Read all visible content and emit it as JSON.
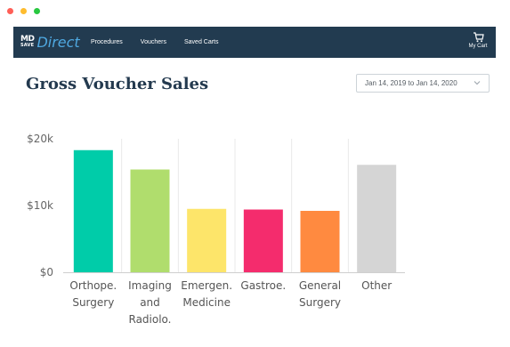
{
  "window": {
    "controls": [
      {
        "name": "close",
        "color": "#ff5f57"
      },
      {
        "name": "minimize",
        "color": "#febc2e"
      },
      {
        "name": "maximize",
        "color": "#28c840"
      }
    ]
  },
  "navbar": {
    "background": "#223b50",
    "logo": {
      "md": "MD",
      "save": "SAVE",
      "direct": "Direct"
    },
    "links": [
      "Procedures",
      "Vouchers",
      "Saved Carts"
    ],
    "cart_label": "My Cart",
    "cart_icon": "shopping-cart-icon"
  },
  "page": {
    "title": "Gross Voucher Sales",
    "date_range": "Jan 14, 2019 to Jan 14, 2020",
    "date_range_icon": "chevron-down-icon"
  },
  "chart_data": {
    "type": "bar",
    "categories": [
      [
        "Orthope.",
        "Surgery"
      ],
      [
        "Imaging",
        "and",
        "Radiolo."
      ],
      [
        "Emergen.",
        "Medicine"
      ],
      [
        "Gastroe."
      ],
      [
        "General",
        "Surgery"
      ],
      [
        "Other"
      ]
    ],
    "values": [
      18300,
      15400,
      9500,
      9400,
      9200,
      16100
    ],
    "colors": [
      "#00cca9",
      "#b0dd6d",
      "#fde56a",
      "#f42c6d",
      "#ff8a40",
      "#d5d5d5"
    ],
    "ylim": [
      0,
      20000
    ],
    "yticks": [
      0,
      10000,
      20000
    ],
    "ytick_labels": [
      "$0",
      "$10k",
      "$20k"
    ],
    "grid": "vertical separators"
  }
}
